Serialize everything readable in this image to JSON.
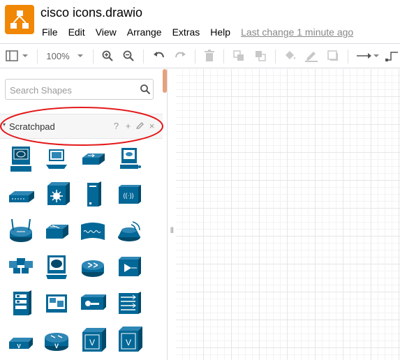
{
  "header": {
    "doc_title": "cisco icons.drawio",
    "menu": [
      "File",
      "Edit",
      "View",
      "Arrange",
      "Extras",
      "Help"
    ],
    "last_change": "Last change 1 minute ago"
  },
  "toolbar": {
    "zoom": "100%"
  },
  "sidebar": {
    "search_placeholder": "Search Shapes",
    "scratchpad": {
      "title": "Scratchpad",
      "help": "?",
      "add": "+",
      "close": "×"
    },
    "shapes": [
      "workstation",
      "pc",
      "switch",
      "terminal",
      "ethernet-switch",
      "multilayer-switch",
      "server",
      "wireless-bridge",
      "wireless-router",
      "workgroup-switch",
      "modem",
      "access-point",
      "pc-group",
      "monitor",
      "router",
      "optical-amplifier",
      "server-rack",
      "video-conference",
      "key-device",
      "patch-panel",
      "vpn-router",
      "voice-router",
      "voice-switch",
      "vpn-concentrator"
    ]
  },
  "colors": {
    "brand": "#f08705",
    "cisco_blue": "#036897",
    "highlight": "#e31a1c"
  }
}
